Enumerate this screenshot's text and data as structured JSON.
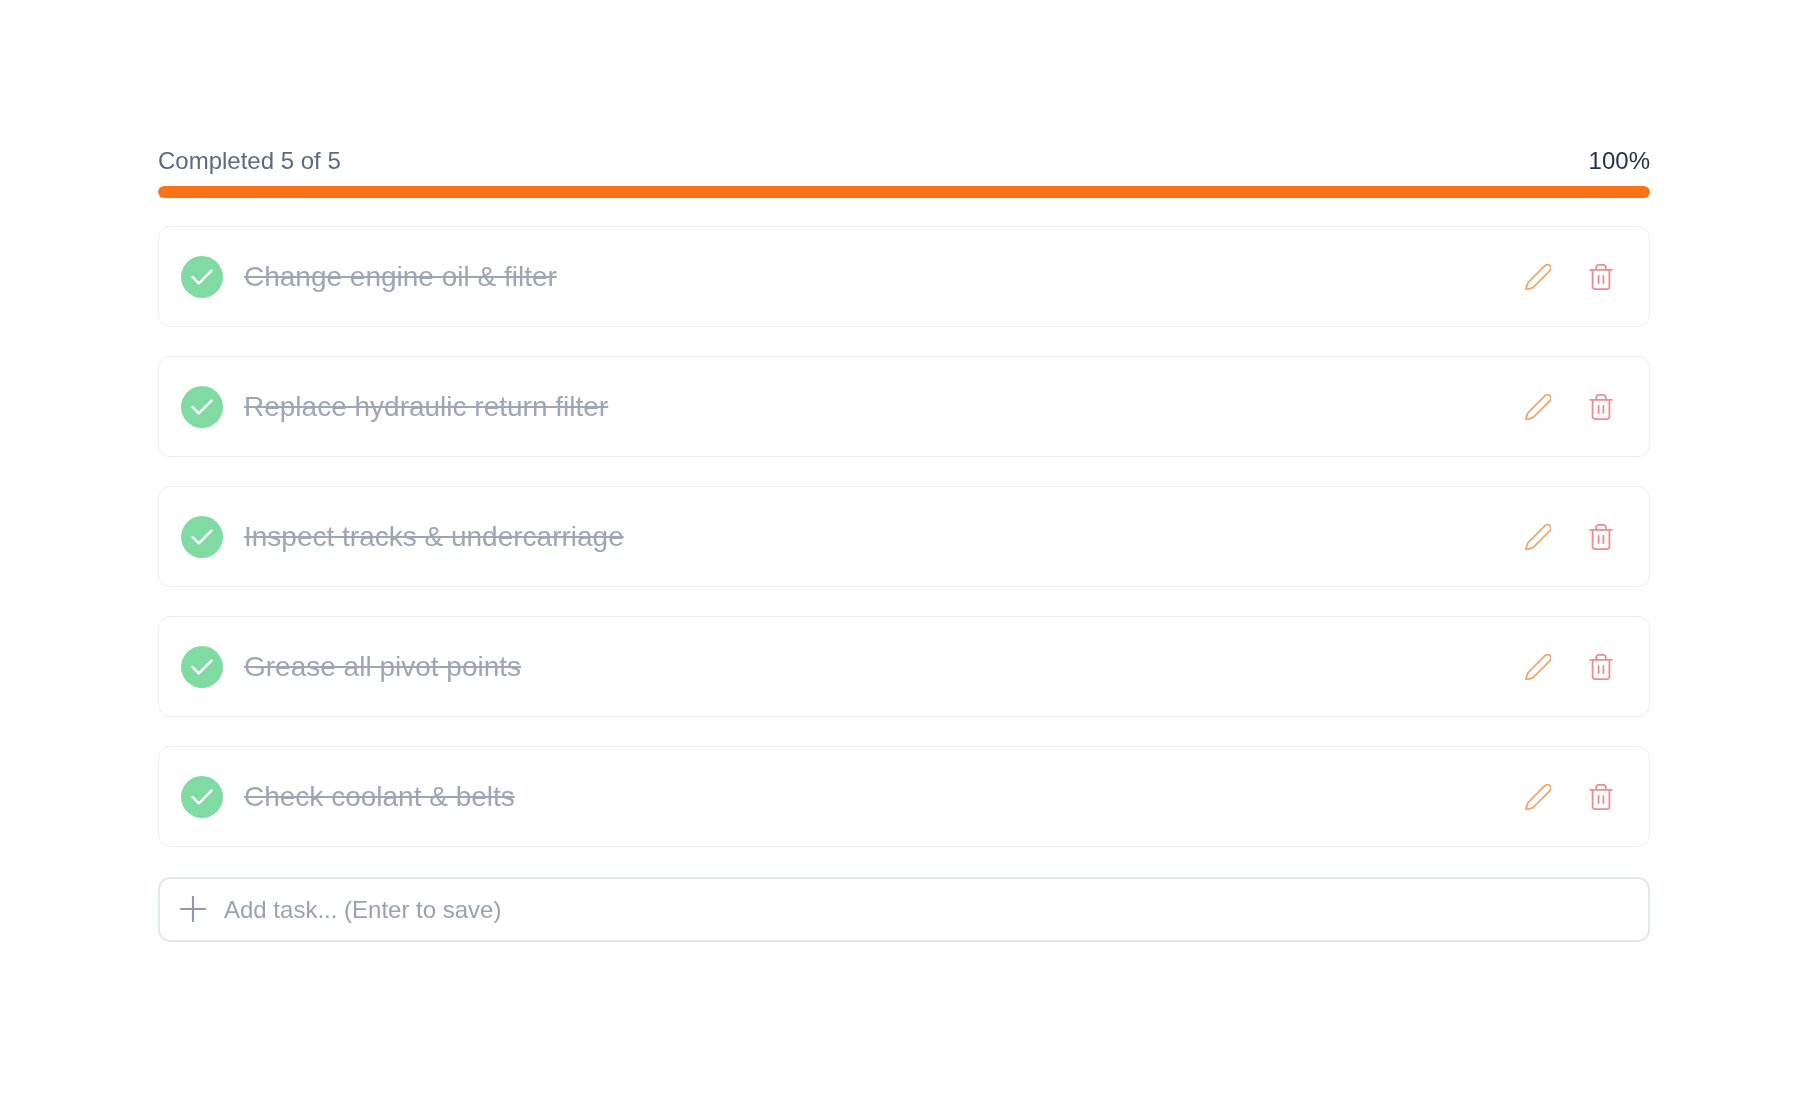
{
  "progress": {
    "label": "Completed 5 of 5",
    "percent": "100%",
    "level": 1
  },
  "tasks": [
    {
      "title": "Change engine oil & filter",
      "done": true
    },
    {
      "title": "Replace hydraulic return filter",
      "done": true
    },
    {
      "title": "Inspect tracks & undercarriage",
      "done": true
    },
    {
      "title": "Grease all pivot points",
      "done": true
    },
    {
      "title": "Check coolant & belts",
      "done": true
    }
  ],
  "new_task": {
    "placeholder": "Add task... (Enter to save)"
  }
}
